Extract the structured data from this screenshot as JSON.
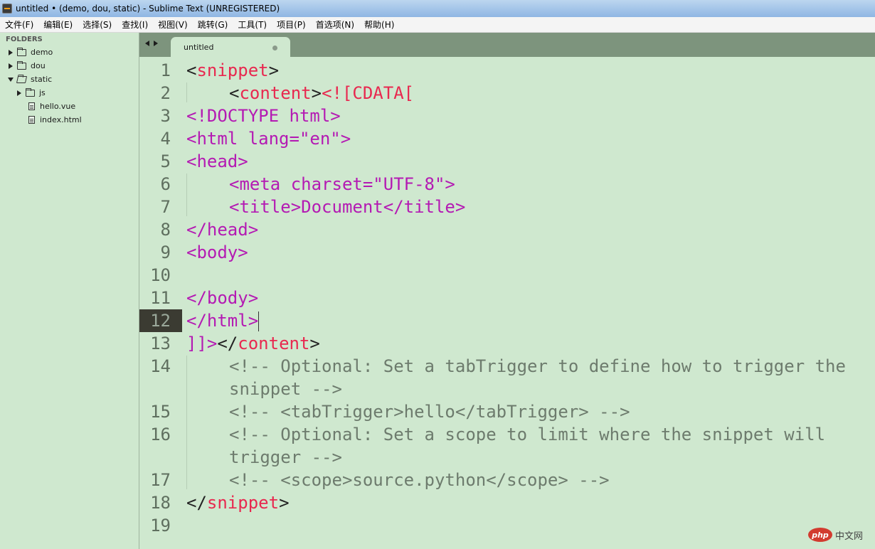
{
  "window": {
    "title": "untitled • (demo, dou, static) - Sublime Text (UNREGISTERED)"
  },
  "menu": [
    "文件(F)",
    "编辑(E)",
    "选择(S)",
    "查找(I)",
    "视图(V)",
    "跳转(G)",
    "工具(T)",
    "项目(P)",
    "首选项(N)",
    "帮助(H)"
  ],
  "sidebar": {
    "header": "FOLDERS",
    "tree": {
      "demo": "demo",
      "dou": "dou",
      "static": "static",
      "js": "js",
      "hello_vue": "hello.vue",
      "index_html": "index.html"
    }
  },
  "tab": {
    "label": "untitled"
  },
  "editor": {
    "active_line": 12,
    "line_numbers": [
      "1",
      "2",
      "3",
      "4",
      "5",
      "6",
      "7",
      "8",
      "9",
      "10",
      "11",
      "12",
      "13",
      "",
      "14",
      "",
      "15",
      "16",
      "",
      "17",
      "18",
      "19"
    ]
  },
  "code": {
    "l1": [
      "<",
      "snippet",
      ">"
    ],
    "l2": [
      "<",
      "content",
      ">",
      "<![CDATA["
    ],
    "l3": "<!DOCTYPE html>",
    "l4": "<html lang=\"en\">",
    "l5": "<head>",
    "l6": "<meta charset=\"UTF-8\">",
    "l7": "<title>Document</title>",
    "l8": "</head>",
    "l9": "<body>",
    "l11": "</body>",
    "l12": "</html>",
    "l13": [
      "]]>",
      "</",
      "content",
      ">"
    ],
    "l14a": "<!-- Optional: Set a tabTrigger to define how to trigger the",
    "l14b": "snippet -->",
    "l15": "<!-- <tabTrigger>hello</tabTrigger> -->",
    "l16a": "<!-- Optional: Set a scope to limit where the snippet will",
    "l16b": "trigger -->",
    "l17": "<!-- <scope>source.python</scope> -->",
    "l18": [
      "</",
      "snippet",
      ">"
    ]
  },
  "watermark": {
    "left": "php",
    "right": "中文网"
  },
  "colors": {
    "editor_bg": "#cfe8cf",
    "tag": "#e8284f",
    "markup": "#b41ab3",
    "comment": "#6d7b6d"
  }
}
